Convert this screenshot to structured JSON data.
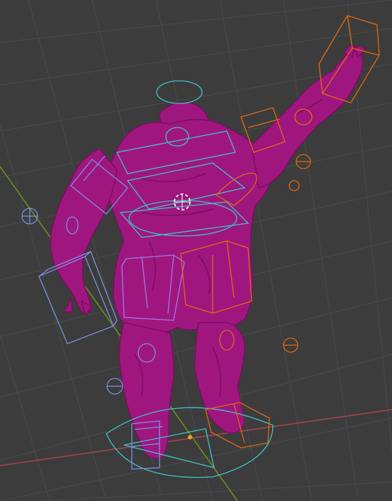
{
  "viewport": {
    "background": "#3c3c3c",
    "grid_color": "#4a4a4a",
    "x_axis_color": "#a8444f",
    "y_axis_color": "#6b8e23"
  },
  "mesh": {
    "name": "muscular-character-mesh",
    "color": "#a0167f",
    "shade_color": "#7a0f60",
    "highlight_color": "#c02aa0"
  },
  "controls": {
    "cyan_color": "#3cc4c8",
    "orange_color": "#e06a10",
    "blue_color": "#7b8fe0",
    "purple_color": "#9b7be6"
  },
  "cursor_3d": {
    "ring_color": "#ffffff",
    "accent_color": "#e04040"
  }
}
